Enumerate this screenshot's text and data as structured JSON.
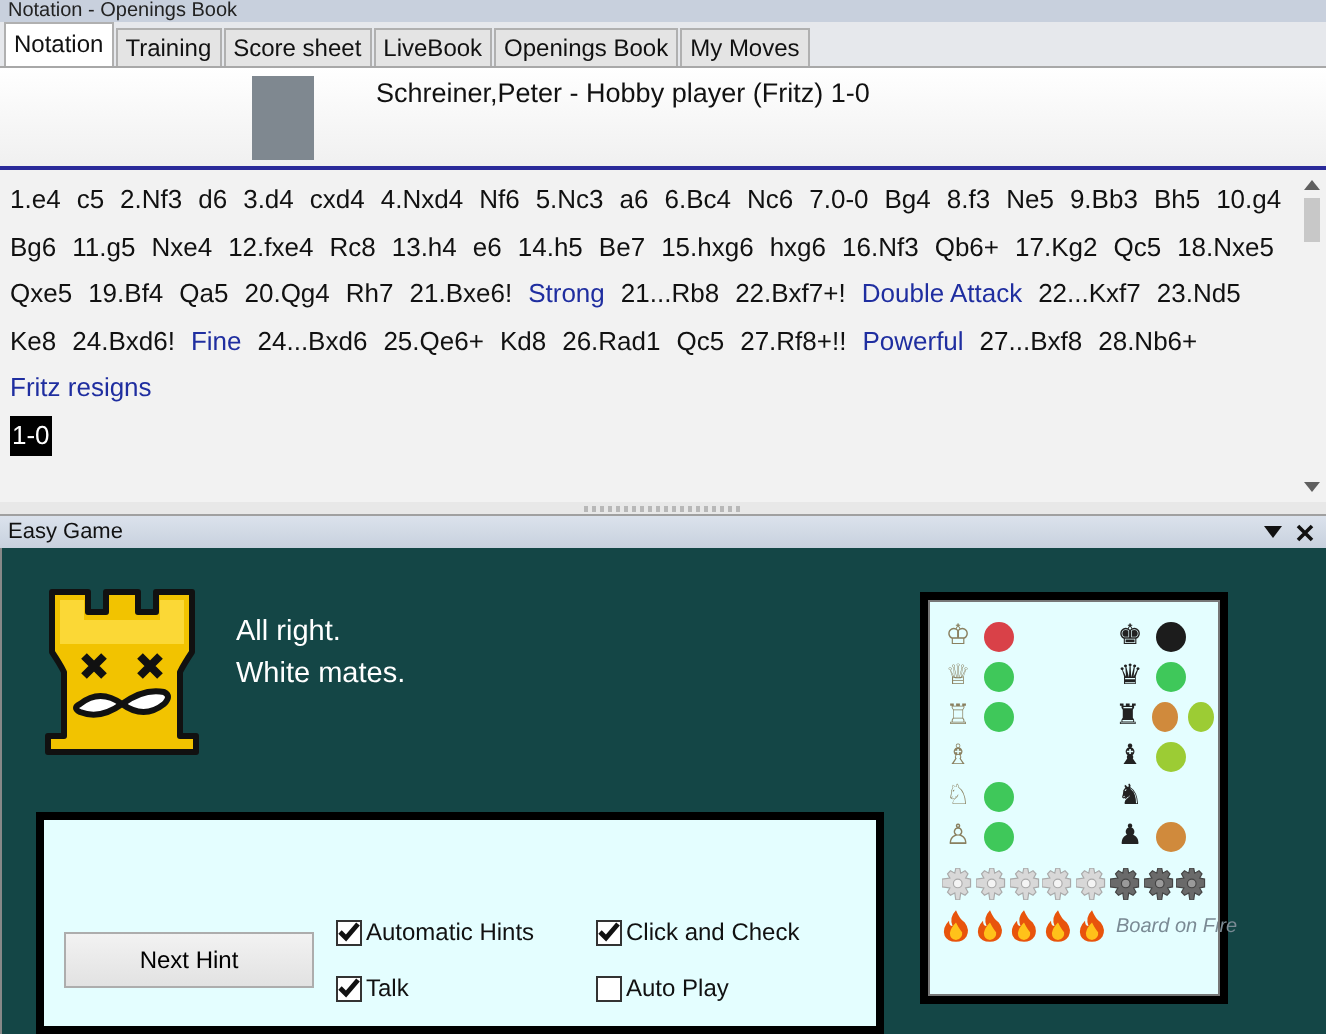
{
  "window": {
    "title": "Notation - Openings Book"
  },
  "tabs": [
    {
      "label": "Notation",
      "selected": true
    },
    {
      "label": "Training",
      "selected": false
    },
    {
      "label": "Score sheet",
      "selected": false
    },
    {
      "label": "LiveBook",
      "selected": false
    },
    {
      "label": "Openings Book",
      "selected": false
    },
    {
      "label": "My Moves",
      "selected": false
    }
  ],
  "game_header": {
    "title": "Schreiner,Peter - Hobby player (Fritz)  1-0"
  },
  "notation": [
    {
      "kind": "move",
      "text": "1.e4"
    },
    {
      "kind": "move",
      "text": "c5"
    },
    {
      "kind": "move",
      "text": "2.Nf3"
    },
    {
      "kind": "move",
      "text": "d6"
    },
    {
      "kind": "move",
      "text": "3.d4"
    },
    {
      "kind": "move",
      "text": "cxd4"
    },
    {
      "kind": "move",
      "text": "4.Nxd4"
    },
    {
      "kind": "move",
      "text": "Nf6"
    },
    {
      "kind": "move",
      "text": "5.Nc3"
    },
    {
      "kind": "move",
      "text": "a6"
    },
    {
      "kind": "move",
      "text": "6.Bc4"
    },
    {
      "kind": "move",
      "text": "Nc6"
    },
    {
      "kind": "move",
      "text": "7.0-0"
    },
    {
      "kind": "move",
      "text": "Bg4"
    },
    {
      "kind": "move",
      "text": "8.f3"
    },
    {
      "kind": "move",
      "text": "Ne5"
    },
    {
      "kind": "move",
      "text": "9.Bb3"
    },
    {
      "kind": "move",
      "text": "Bh5"
    },
    {
      "kind": "move",
      "text": "10.g4"
    },
    {
      "kind": "move",
      "text": "Bg6"
    },
    {
      "kind": "move",
      "text": "11.g5"
    },
    {
      "kind": "move",
      "text": "Nxe4"
    },
    {
      "kind": "move",
      "text": "12.fxe4"
    },
    {
      "kind": "move",
      "text": "Rc8"
    },
    {
      "kind": "move",
      "text": "13.h4"
    },
    {
      "kind": "move",
      "text": "e6"
    },
    {
      "kind": "move",
      "text": "14.h5"
    },
    {
      "kind": "move",
      "text": "Be7"
    },
    {
      "kind": "move",
      "text": "15.hxg6"
    },
    {
      "kind": "move",
      "text": "hxg6"
    },
    {
      "kind": "move",
      "text": "16.Nf3"
    },
    {
      "kind": "move",
      "text": "Qb6+"
    },
    {
      "kind": "move",
      "text": "17.Kg2"
    },
    {
      "kind": "move",
      "text": "Qc5"
    },
    {
      "kind": "move",
      "text": "18.Nxe5"
    },
    {
      "kind": "move",
      "text": "Qxe5"
    },
    {
      "kind": "move",
      "text": "19.Bf4"
    },
    {
      "kind": "move",
      "text": "Qa5"
    },
    {
      "kind": "move",
      "text": "20.Qg4"
    },
    {
      "kind": "move",
      "text": "Rh7"
    },
    {
      "kind": "move",
      "text": "21.Bxe6!"
    },
    {
      "kind": "comment",
      "text": "Strong"
    },
    {
      "kind": "move",
      "text": "21...Rb8"
    },
    {
      "kind": "move",
      "text": "22.Bxf7+!"
    },
    {
      "kind": "comment",
      "text": "Double Attack"
    },
    {
      "kind": "move",
      "text": "22...Kxf7"
    },
    {
      "kind": "move",
      "text": "23.Nd5"
    },
    {
      "kind": "move",
      "text": "Ke8"
    },
    {
      "kind": "move",
      "text": "24.Bxd6!"
    },
    {
      "kind": "comment",
      "text": "Fine"
    },
    {
      "kind": "move",
      "text": "24...Bxd6"
    },
    {
      "kind": "move",
      "text": "25.Qe6+"
    },
    {
      "kind": "move",
      "text": "Kd8"
    },
    {
      "kind": "move",
      "text": "26.Rad1"
    },
    {
      "kind": "move",
      "text": "Qc5"
    },
    {
      "kind": "move",
      "text": "27.Rf8+!!"
    },
    {
      "kind": "comment",
      "text": "Powerful"
    },
    {
      "kind": "move",
      "text": "27...Bxf8"
    },
    {
      "kind": "move",
      "text": "28.Nb6+"
    },
    {
      "kind": "comment",
      "text": "Fritz resigns"
    },
    {
      "kind": "result",
      "text": "1-0"
    }
  ],
  "easy_game": {
    "title": "Easy Game",
    "message": [
      "All right.",
      "White mates."
    ],
    "button": "Next Hint",
    "options": [
      {
        "label": "Automatic Hints",
        "checked": true
      },
      {
        "label": "Click and Check",
        "checked": true
      },
      {
        "label": "Talk",
        "checked": true
      },
      {
        "label": "Auto Play",
        "checked": false
      }
    ],
    "pieces": [
      {
        "white": {
          "piece": "♔",
          "dots": [
            {
              "color": "#d94148"
            }
          ]
        },
        "black": {
          "piece": "♚",
          "dots": [
            {
              "color": "#1c1c1c"
            }
          ]
        }
      },
      {
        "white": {
          "piece": "♕",
          "dots": [
            {
              "color": "#3fc85a"
            }
          ]
        },
        "black": {
          "piece": "♛",
          "dots": [
            {
              "color": "#3fc85a"
            }
          ]
        }
      },
      {
        "white": {
          "piece": "♖",
          "dots": [
            {
              "color": "#3fc85a"
            }
          ]
        },
        "black": {
          "piece": "♜",
          "dots": [
            {
              "color": "#d08a3c"
            },
            {
              "color": "#9ccc34"
            }
          ]
        }
      },
      {
        "white": {
          "piece": "♗"
        },
        "black": {
          "piece": "♝",
          "dots": [
            {
              "color": "#9ccc34"
            }
          ]
        }
      },
      {
        "white": {
          "piece": "♘",
          "dots": [
            {
              "color": "#3fc85a"
            }
          ]
        },
        "black": {
          "piece": "♞"
        }
      },
      {
        "white": {
          "piece": "♙",
          "dots": [
            {
              "color": "#3fc85a"
            }
          ]
        },
        "black": {
          "piece": "♟",
          "dots": [
            {
              "color": "#d08a3c"
            }
          ]
        }
      }
    ],
    "gears": [
      {
        "on": false
      },
      {
        "on": false
      },
      {
        "on": false
      },
      {
        "on": false
      },
      {
        "on": false
      },
      {
        "on": true
      },
      {
        "on": true
      },
      {
        "on": true
      }
    ],
    "fire": {
      "flames": [
        {
          "on": true
        },
        {
          "on": true
        },
        {
          "on": true
        },
        {
          "on": true
        },
        {
          "on": true
        }
      ],
      "label": "Board on Fire"
    }
  }
}
